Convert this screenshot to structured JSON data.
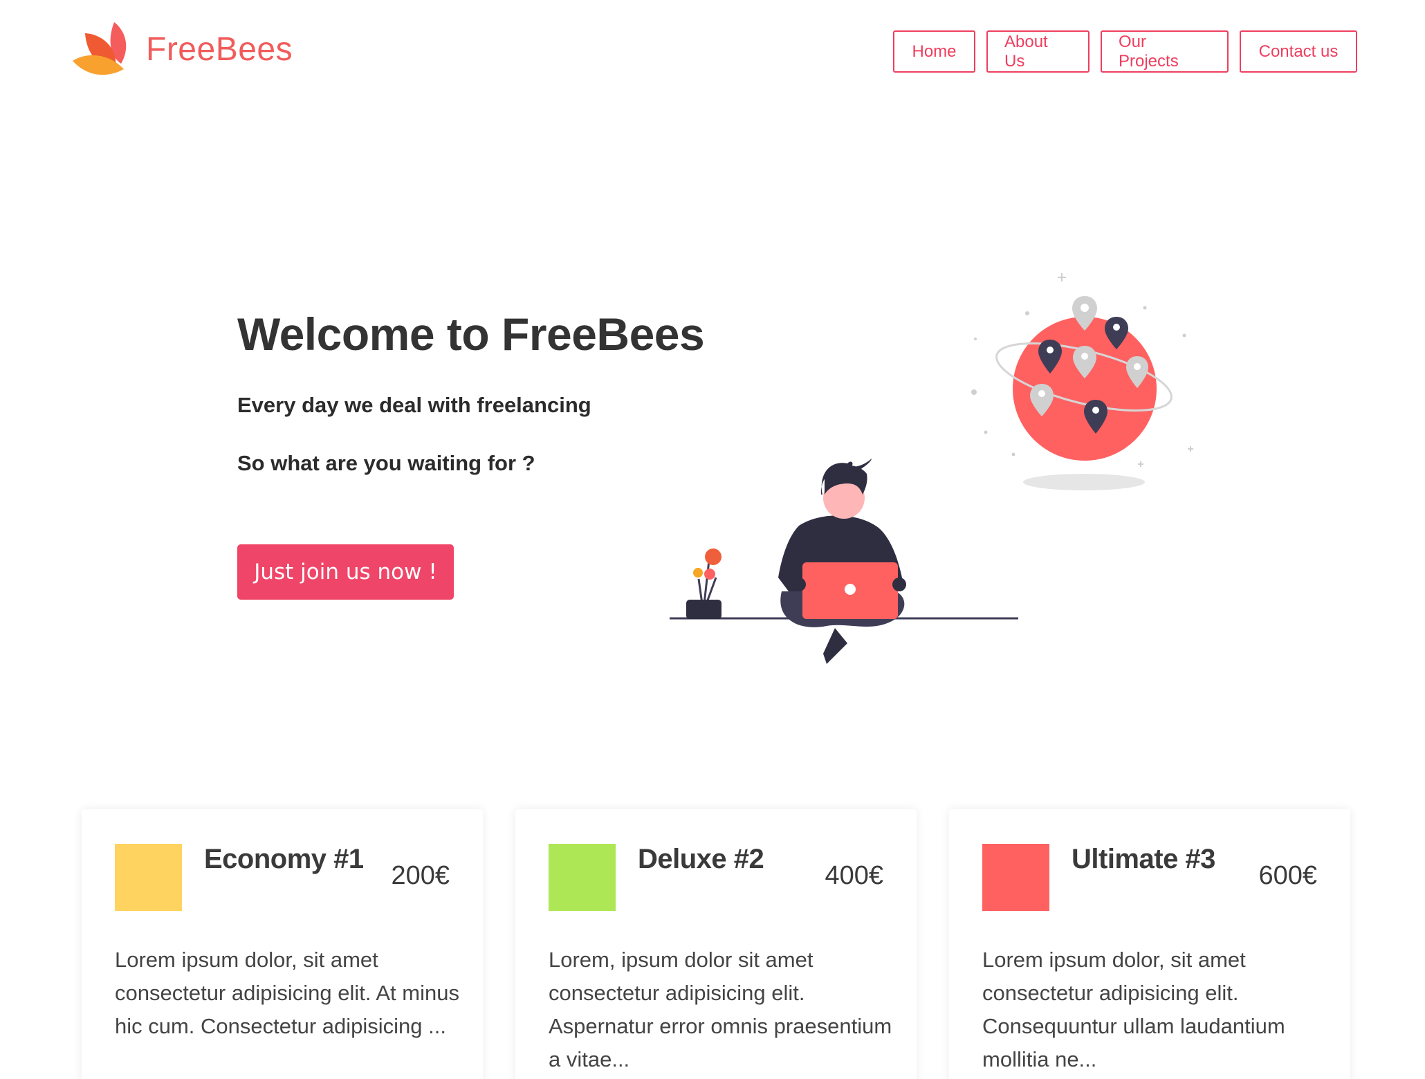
{
  "brand": {
    "name": "FreeBees"
  },
  "nav": {
    "items": [
      {
        "label": "Home"
      },
      {
        "label": "About Us"
      },
      {
        "label": "Our Projects"
      },
      {
        "label": "Contact us"
      }
    ],
    "accent_color": "#ee3e5e"
  },
  "hero": {
    "title": "Welcome to FreeBees",
    "subtitle1": "Every day we deal with freelancing",
    "subtitle2": "So what are you waiting for ?",
    "cta_label": "Just join us now !",
    "cta_color": "#ef4568",
    "illustration_icon": "freelancer-with-laptop-and-globe-illustration"
  },
  "plans": [
    {
      "name": "Economy #1",
      "price": "200€",
      "color": "#ffd35f",
      "description": "Lorem ipsum dolor, sit amet consectetur adipisicing elit. At minus hic cum. Consectetur adipisicing ..."
    },
    {
      "name": "Deluxe #2",
      "price": "400€",
      "color": "#aee756",
      "description": "Lorem, ipsum dolor sit amet consectetur adipisicing elit. Aspernatur error omnis praesentium a vitae..."
    },
    {
      "name": "Ultimate #3",
      "price": "600€",
      "color": "#ff6161",
      "description": "Lorem ipsum dolor, sit amet consectetur adipisicing elit. Consequuntur ullam laudantium mollitia ne..."
    }
  ]
}
